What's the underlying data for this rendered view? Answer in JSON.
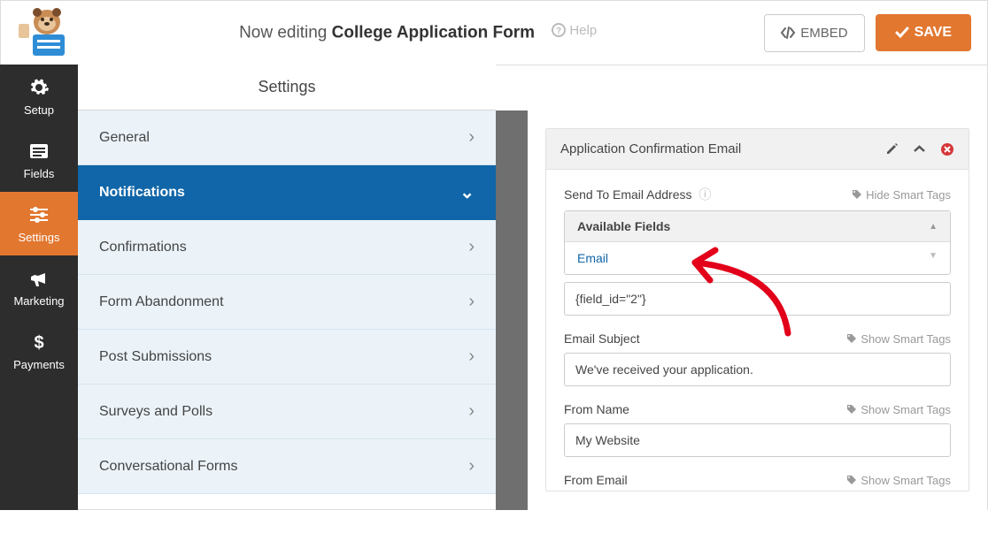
{
  "header": {
    "editing_prefix": "Now editing",
    "form_name": "College Application Form",
    "help_label": "Help",
    "embed_label": "EMBED",
    "save_label": "SAVE"
  },
  "rail": [
    {
      "key": "setup",
      "label": "Setup"
    },
    {
      "key": "fields",
      "label": "Fields"
    },
    {
      "key": "settings",
      "label": "Settings"
    },
    {
      "key": "marketing",
      "label": "Marketing"
    },
    {
      "key": "payments",
      "label": "Payments"
    }
  ],
  "panel_title": "Settings",
  "settings_items": [
    {
      "label": "General",
      "active": false
    },
    {
      "label": "Notifications",
      "active": true
    },
    {
      "label": "Confirmations",
      "active": false
    },
    {
      "label": "Form Abandonment",
      "active": false
    },
    {
      "label": "Post Submissions",
      "active": false
    },
    {
      "label": "Surveys and Polls",
      "active": false
    },
    {
      "label": "Conversational Forms",
      "active": false
    }
  ],
  "card": {
    "title": "Application Confirmation Email",
    "sections": {
      "send_to": {
        "label": "Send To Email Address",
        "hint": "Hide Smart Tags",
        "picker_title": "Available Fields",
        "picker_option": "Email",
        "value": "{field_id=\"2\"}"
      },
      "subject": {
        "label": "Email Subject",
        "hint": "Show Smart Tags",
        "value": "We've received your application."
      },
      "from_name": {
        "label": "From Name",
        "hint": "Show Smart Tags",
        "value": "My Website"
      },
      "from_email": {
        "label": "From Email",
        "hint": "Show Smart Tags"
      }
    }
  }
}
